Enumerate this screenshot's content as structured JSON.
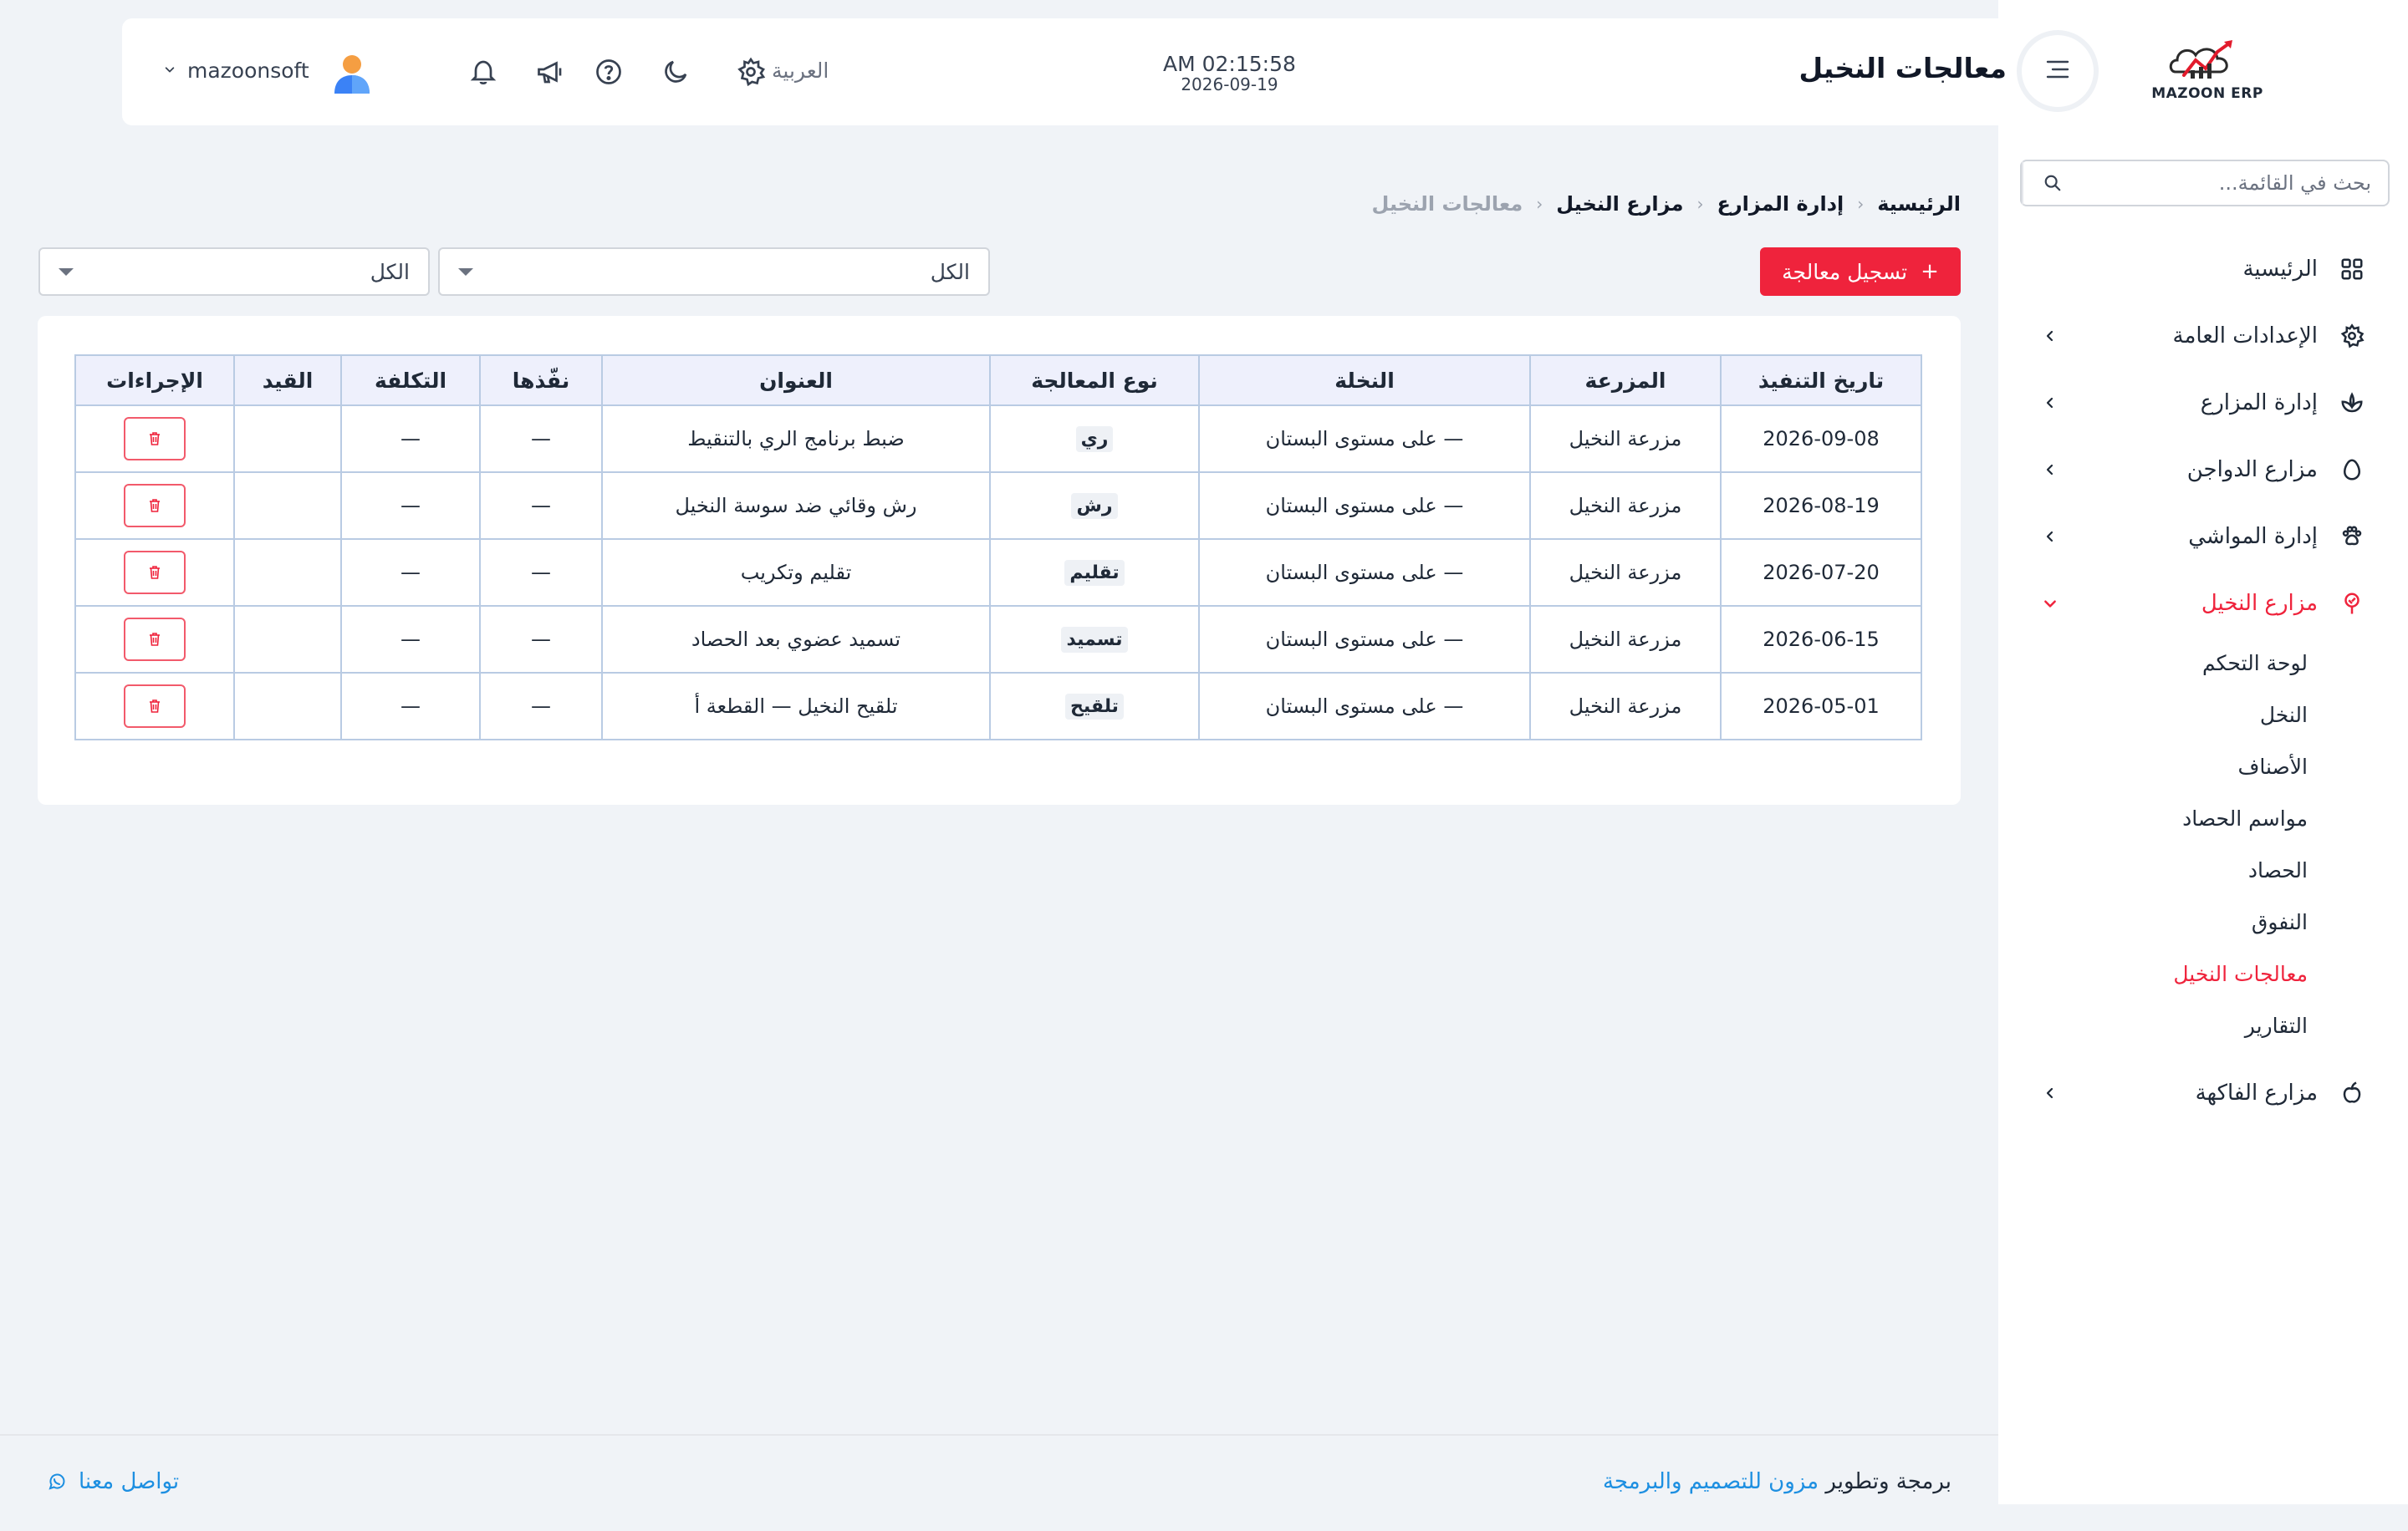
{
  "brand": {
    "logo_text": "MAZOON ERP",
    "logo_small": "ERP"
  },
  "sidebar": {
    "search_placeholder": "بحث في القائمة...",
    "items": [
      {
        "label": "الرئيسية",
        "icon": "grid-icon",
        "has_children": false
      },
      {
        "label": "الإعدادات العامة",
        "icon": "gear-icon",
        "has_children": true
      },
      {
        "label": "إدارة المزارع",
        "icon": "leaf-icon",
        "has_children": true
      },
      {
        "label": "مزارع الدواجن",
        "icon": "egg-icon",
        "has_children": true
      },
      {
        "label": "إدارة المواشي",
        "icon": "paw-icon",
        "has_children": true
      },
      {
        "label": "مزارع النخيل",
        "icon": "palm-icon",
        "has_children": true,
        "expanded": true
      },
      {
        "label": "مزارع الفاكهة",
        "icon": "fruit-icon",
        "has_children": true
      }
    ],
    "palm_submenu": [
      "لوحة التحكم",
      "النخل",
      "الأصناف",
      "مواسم الحصاد",
      "الحصاد",
      "النفوق",
      "معالجات النخيل",
      "التقارير"
    ],
    "active_sub": "معالجات النخيل"
  },
  "header": {
    "title": "معالجات النخيل",
    "time": "AM 02:15:58",
    "date": "2026-09-19",
    "language": "العربية",
    "username": "mazoonsoft"
  },
  "breadcrumb": [
    "الرئيسية",
    "إدارة المزارع",
    "مزارع النخيل",
    "معالجات النخيل"
  ],
  "toolbar": {
    "add_label": "تسجيل معالجة",
    "filter1_value": "الكل",
    "filter2_value": "الكل"
  },
  "table": {
    "columns": [
      "تاريخ التنفيذ",
      "المزرعة",
      "النخلة",
      "نوع المعالجة",
      "العنوان",
      "نفّذها",
      "التكلفة",
      "القيد",
      "الإجراءات"
    ],
    "rows": [
      {
        "date": "2026-09-08",
        "farm": "مزرعة النخيل",
        "palm": "— على مستوى البستان",
        "type": "ري",
        "title": "ضبط برنامج الري بالتنقيط",
        "by": "—",
        "cost": "—",
        "entry": ""
      },
      {
        "date": "2026-08-19",
        "farm": "مزرعة النخيل",
        "palm": "— على مستوى البستان",
        "type": "رش",
        "title": "رش وقائي ضد سوسة النخيل",
        "by": "—",
        "cost": "—",
        "entry": ""
      },
      {
        "date": "2026-07-20",
        "farm": "مزرعة النخيل",
        "palm": "— على مستوى البستان",
        "type": "تقليم",
        "title": "تقليم وتكريب",
        "by": "—",
        "cost": "—",
        "entry": ""
      },
      {
        "date": "2026-06-15",
        "farm": "مزرعة النخيل",
        "palm": "— على مستوى البستان",
        "type": "تسميد",
        "title": "تسميد عضوي بعد الحصاد",
        "by": "—",
        "cost": "—",
        "entry": ""
      },
      {
        "date": "2026-05-01",
        "farm": "مزرعة النخيل",
        "palm": "— على مستوى البستان",
        "type": "تلقيح",
        "title": "تلقيح النخيل — القطعة أ",
        "by": "—",
        "cost": "—",
        "entry": ""
      }
    ]
  },
  "footer": {
    "credit_prefix": "برمجة وتطوير",
    "credit_link": "مزون للتصميم والبرمجة",
    "contact": "تواصل معنا"
  },
  "colors": {
    "accent": "#ef233c",
    "link": "#1d8fe1",
    "table_header": "#eef0fc"
  }
}
